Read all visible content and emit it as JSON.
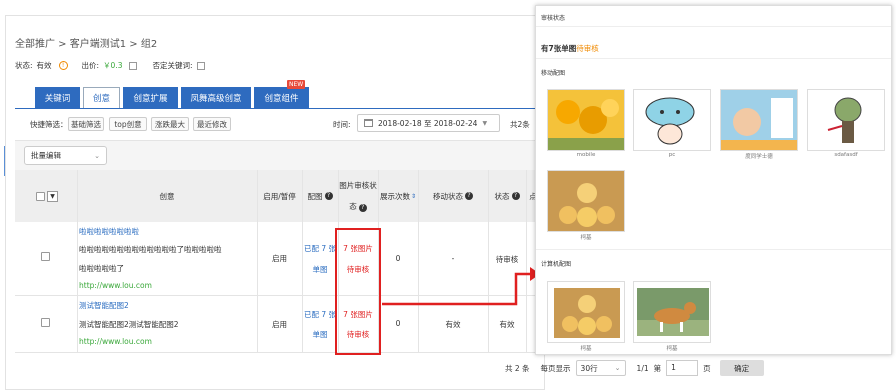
{
  "breadcrumb": "全部推广 > 客户端测试1 > 组2",
  "status": {
    "status_label": "状态:",
    "status_value": "有效",
    "bid_label": "出价:",
    "bid_value": "￥0.3",
    "negative_label": "否定关键词:"
  },
  "tabs": [
    {
      "label": "关键词",
      "active": false
    },
    {
      "label": "创意",
      "active": true
    },
    {
      "label": "创意扩展",
      "active": false
    },
    {
      "label": "凤舞高级创意",
      "active": false
    },
    {
      "label": "创意组件",
      "active": false,
      "badge": "NEW"
    }
  ],
  "filters": {
    "label": "快捷筛选：",
    "chips": [
      "基础筛选",
      "top创意",
      "涨跌最大",
      "最近修改"
    ],
    "time_label": "时间:",
    "date_range": "2018-02-18 至 2018-02-24",
    "total_top": "共2条"
  },
  "bulk_select": "批量编辑",
  "table": {
    "headers": {
      "creative": "创意",
      "toggle": "启用/暂停",
      "config": "配图",
      "image_status_1": "图片审核状",
      "image_status_2": "态",
      "impressions": "展示次数",
      "mobile_status": "移动状态",
      "status": "状态",
      "more": "点"
    },
    "rows": [
      {
        "title": "啦啦啦啦啦啦啦啦",
        "line1": "啦啦啦啦啦啦啦啦啦啦啦啦啦了啦啦啦啦啦",
        "line2": "啦啦啦啦啦了",
        "url": "http://www.lou.com",
        "toggle": "启用",
        "config_1": "已配 7 张",
        "config_2": "单图",
        "img_1": "7 张图片",
        "img_2": "待审核",
        "impressions": "0",
        "mobile": "-",
        "status": "待审核"
      },
      {
        "title": "测试智能配图2",
        "line1": "测试智能配图2测试智能配图2",
        "line2": "",
        "url": "http://www.lou.com",
        "toggle": "启用",
        "config_1": "已配 7 张",
        "config_2": "单图",
        "img_1": "7 张图片",
        "img_2": "待审核",
        "impressions": "0",
        "mobile": "有效",
        "status": "有效"
      }
    ]
  },
  "pagination": {
    "total": "共 2 条",
    "per_page_label": "每页显示",
    "per_page": "30行",
    "page_info": "1/1",
    "goto_label": "第",
    "goto_value": "1",
    "page_suffix": "页",
    "confirm": "确定"
  },
  "panel": {
    "title": "审核状态",
    "summary_prefix": "有7张单图",
    "summary_status": "待审核",
    "mobile_section": "移动配图",
    "mobile_images": [
      {
        "caption": "mobile",
        "icon": "tulip-image"
      },
      {
        "caption": "pc",
        "icon": "cartoon-mushroom-image"
      },
      {
        "caption": "度同学士德",
        "icon": "anime-character-image"
      },
      {
        "caption": "sdafasdf",
        "icon": "zombie-image"
      },
      {
        "caption": "柯基",
        "icon": "plush-dogs-image"
      }
    ],
    "pc_section": "计算机配图",
    "pc_images": [
      {
        "caption": "柯基",
        "icon": "plush-dogs-image"
      },
      {
        "caption": "柯基",
        "icon": "corgi-image"
      }
    ]
  },
  "colors": {
    "accent": "#2e6bbf",
    "highlight": "#e02020",
    "orange": "#f08a00"
  }
}
